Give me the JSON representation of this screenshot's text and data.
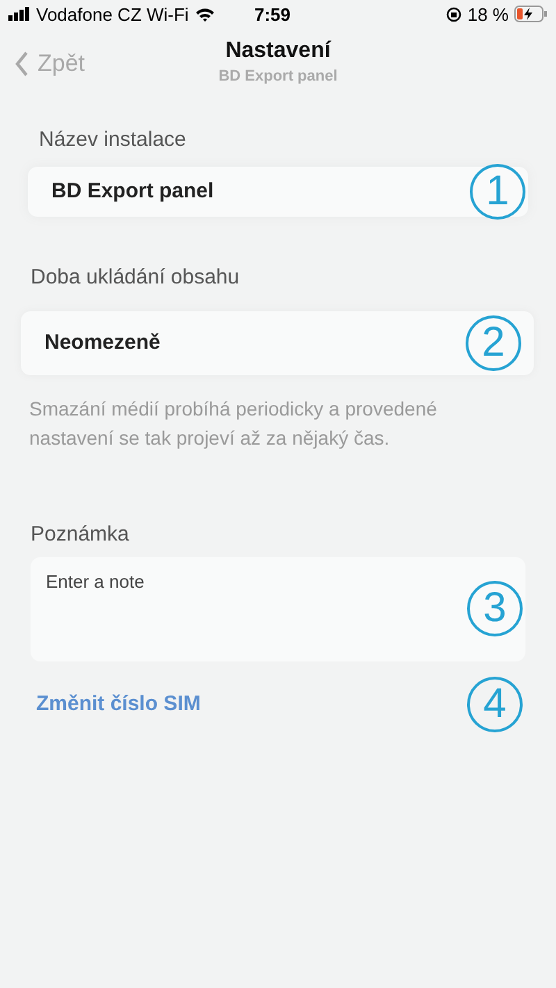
{
  "status_bar": {
    "carrier": "Vodafone CZ Wi-Fi",
    "time": "7:59",
    "battery": "18 %"
  },
  "nav": {
    "back": "Zpět",
    "title": "Nastavení",
    "subtitle": "BD Export panel"
  },
  "sections": [
    {
      "kind": "field",
      "label": "Název instalace",
      "value": "BD Export panel",
      "marker": "1"
    },
    {
      "kind": "select",
      "label": "Doba ukládání obsahu",
      "value": "Neomezeně",
      "marker": "2",
      "help": "Smazání médií probíhá periodicky a provedené nastavení se tak projeví až za nějaký čas."
    },
    {
      "kind": "note",
      "label": "Poznámka",
      "placeholder": "Enter a note",
      "marker": "3"
    },
    {
      "kind": "link",
      "text": "Změnit číslo SIM",
      "marker": "4"
    }
  ]
}
